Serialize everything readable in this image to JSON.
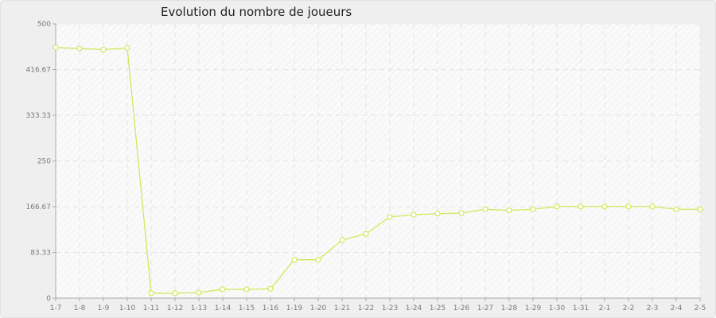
{
  "chart_data": {
    "type": "line",
    "title": "Evolution du nombre de joueurs",
    "xlabel": "",
    "ylabel": "",
    "ylim": [
      0,
      500
    ],
    "yticks": [
      "0",
      "83.33",
      "166.67",
      "250",
      "333.33",
      "416.67",
      "500"
    ],
    "grid": true,
    "legend": "none",
    "categories": [
      "1-7",
      "1-8",
      "1-9",
      "1-10",
      "1-11",
      "1-12",
      "1-13",
      "1-14",
      "1-15",
      "1-16",
      "1-19",
      "1-20",
      "1-21",
      "1-22",
      "1-23",
      "1-24",
      "1-25",
      "1-26",
      "1-27",
      "1-28",
      "1-29",
      "1-30",
      "1-31",
      "2-1",
      "2-2",
      "2-3",
      "2-4",
      "2-5"
    ],
    "series": [
      {
        "values": [
          457,
          455,
          453,
          456,
          9,
          9,
          10,
          16,
          16,
          17,
          70,
          70,
          106,
          117,
          148,
          152,
          154,
          155,
          162,
          160,
          162,
          167,
          167,
          167,
          167,
          167,
          162,
          162
        ],
        "color": "#d2e85c"
      }
    ]
  }
}
